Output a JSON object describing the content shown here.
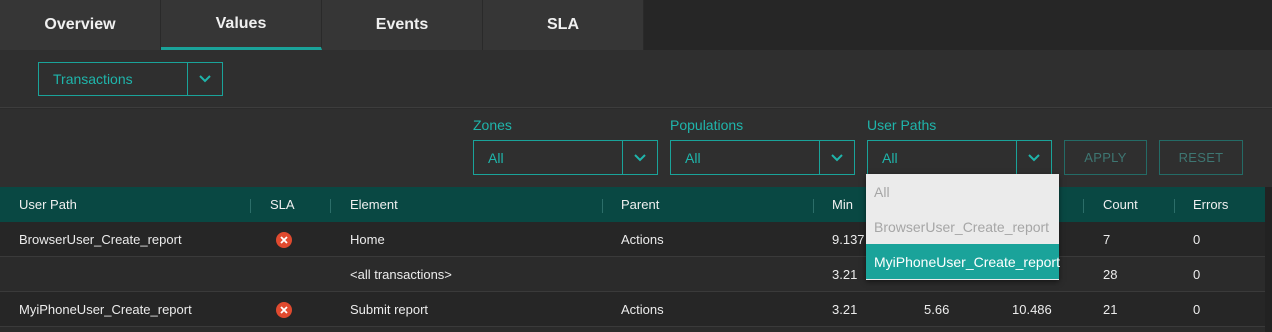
{
  "tabs": [
    {
      "label": "Overview"
    },
    {
      "label": "Values"
    },
    {
      "label": "Events"
    },
    {
      "label": "SLA"
    }
  ],
  "toolbar": {
    "view_select": {
      "value": "Transactions"
    }
  },
  "filters": {
    "zones": {
      "label": "Zones",
      "value": "All"
    },
    "populations": {
      "label": "Populations",
      "value": "All"
    },
    "user_paths": {
      "label": "User Paths",
      "value": "All"
    },
    "apply_label": "APPLY",
    "reset_label": "RESET"
  },
  "user_paths_dropdown": {
    "options": [
      "All",
      "BrowserUser_Create_report",
      "MyiPhoneUser_Create_report"
    ],
    "highlighted": "MyiPhoneUser_Create_report"
  },
  "table": {
    "columns": [
      "User Path",
      "SLA",
      "Element",
      "Parent",
      "Min",
      "Count",
      "Errors"
    ],
    "rows": [
      {
        "user_path": "BrowserUser_Create_report",
        "sla": "error-icon",
        "element": "Home",
        "parent": "Actions",
        "min": "9.137",
        "avg": "",
        "max": "",
        "count": "7",
        "errors": "0"
      },
      {
        "user_path": "",
        "sla": "",
        "element": "<all transactions>",
        "parent": "",
        "min": "3.21",
        "avg": "",
        "max": "",
        "count": "28",
        "errors": "0"
      },
      {
        "user_path": "MyiPhoneUser_Create_report",
        "sla": "error-icon",
        "element": "Submit report",
        "parent": "Actions",
        "min": "3.21",
        "avg": "5.66",
        "max": "10.486",
        "count": "21",
        "errors": "0"
      }
    ]
  },
  "colors": {
    "accent": "#1aa39a",
    "header_bg": "#094843",
    "error": "#e04a2f"
  }
}
